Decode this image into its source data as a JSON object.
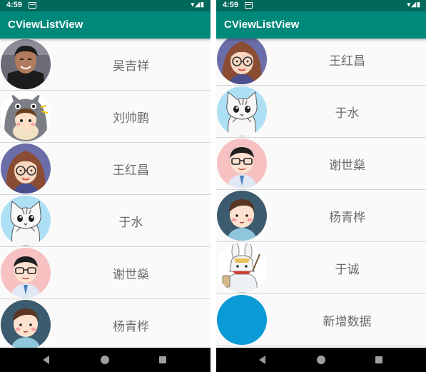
{
  "status_bar": {
    "time": "4:59",
    "icons": "▾◢▮"
  },
  "app_title": "CViewListView",
  "left_list": [
    {
      "name": "吴吉祥",
      "avatar": "photo-avatar"
    },
    {
      "name": "刘帅鹏",
      "avatar": "totoro-girl-avatar"
    },
    {
      "name": "王红昌",
      "avatar": "glasses-woman-avatar"
    },
    {
      "name": "于水",
      "avatar": "cat-avatar"
    },
    {
      "name": "谢世燊",
      "avatar": "glasses-boy-avatar"
    },
    {
      "name": "杨青桦",
      "avatar": "boy-avatar"
    }
  ],
  "right_list": [
    {
      "name": "王红昌",
      "avatar": "glasses-woman-avatar"
    },
    {
      "name": "于水",
      "avatar": "cat-avatar"
    },
    {
      "name": "谢世燊",
      "avatar": "glasses-boy-avatar"
    },
    {
      "name": "杨青桦",
      "avatar": "boy-avatar"
    },
    {
      "name": "于诚",
      "avatar": "rabbit-avatar"
    },
    {
      "name": "新增数据",
      "avatar": "blue-circle-avatar"
    }
  ],
  "colors": {
    "status_bar": "#00695c",
    "app_bar": "#00897b",
    "new_item_avatar": "#0a9ad6"
  }
}
